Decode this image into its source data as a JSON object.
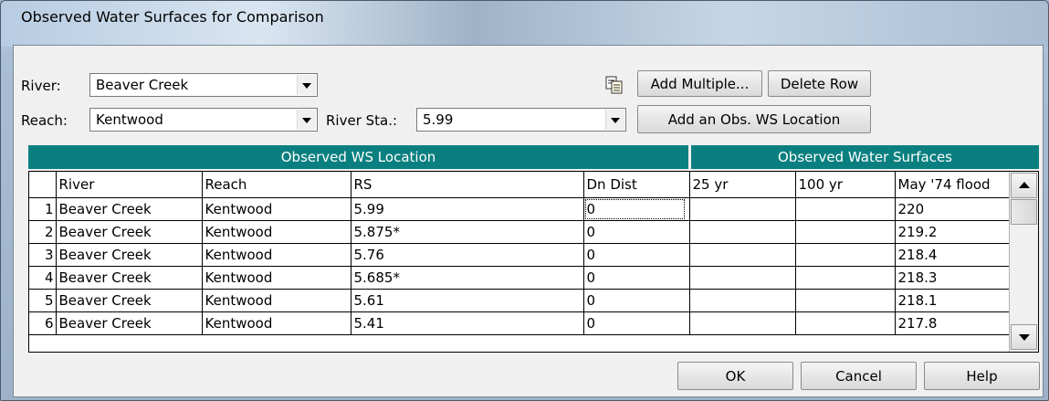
{
  "window": {
    "title": "Observed Water Surfaces for Comparison"
  },
  "river": {
    "label": "River:",
    "value": "Beaver Creek"
  },
  "reach": {
    "label": "Reach:",
    "value": "Kentwood"
  },
  "river_sta": {
    "label": "River Sta.:",
    "value": "5.99"
  },
  "toolbar": {
    "copy_icon": "copy-icon",
    "add_multiple": "Add Multiple...",
    "delete_row": "Delete Row",
    "add_location": "Add an Obs. WS Location"
  },
  "groups": {
    "location": "Observed WS Location",
    "surfaces": "Observed Water Surfaces"
  },
  "table": {
    "columns": [
      "River",
      "Reach",
      "RS",
      "Dn Dist",
      "25 yr",
      "100 yr",
      "May '74 flood"
    ],
    "rows": [
      {
        "n": "1",
        "river": "Beaver Creek",
        "reach": "Kentwood",
        "rs": "5.99",
        "dn": "0",
        "y25": "",
        "y100": "",
        "may74": "220"
      },
      {
        "n": "2",
        "river": "Beaver Creek",
        "reach": "Kentwood",
        "rs": "5.875*",
        "dn": "0",
        "y25": "",
        "y100": "",
        "may74": "219.2"
      },
      {
        "n": "3",
        "river": "Beaver Creek",
        "reach": "Kentwood",
        "rs": "5.76",
        "dn": "0",
        "y25": "",
        "y100": "",
        "may74": "218.4"
      },
      {
        "n": "4",
        "river": "Beaver Creek",
        "reach": "Kentwood",
        "rs": "5.685*",
        "dn": "0",
        "y25": "",
        "y100": "",
        "may74": "218.3"
      },
      {
        "n": "5",
        "river": "Beaver Creek",
        "reach": "Kentwood",
        "rs": "5.61",
        "dn": "0",
        "y25": "",
        "y100": "",
        "may74": "218.1"
      },
      {
        "n": "6",
        "river": "Beaver Creek",
        "reach": "Kentwood",
        "rs": "5.41",
        "dn": "0",
        "y25": "",
        "y100": "",
        "may74": "217.8"
      }
    ]
  },
  "footer": {
    "ok": "OK",
    "cancel": "Cancel",
    "help": "Help"
  }
}
